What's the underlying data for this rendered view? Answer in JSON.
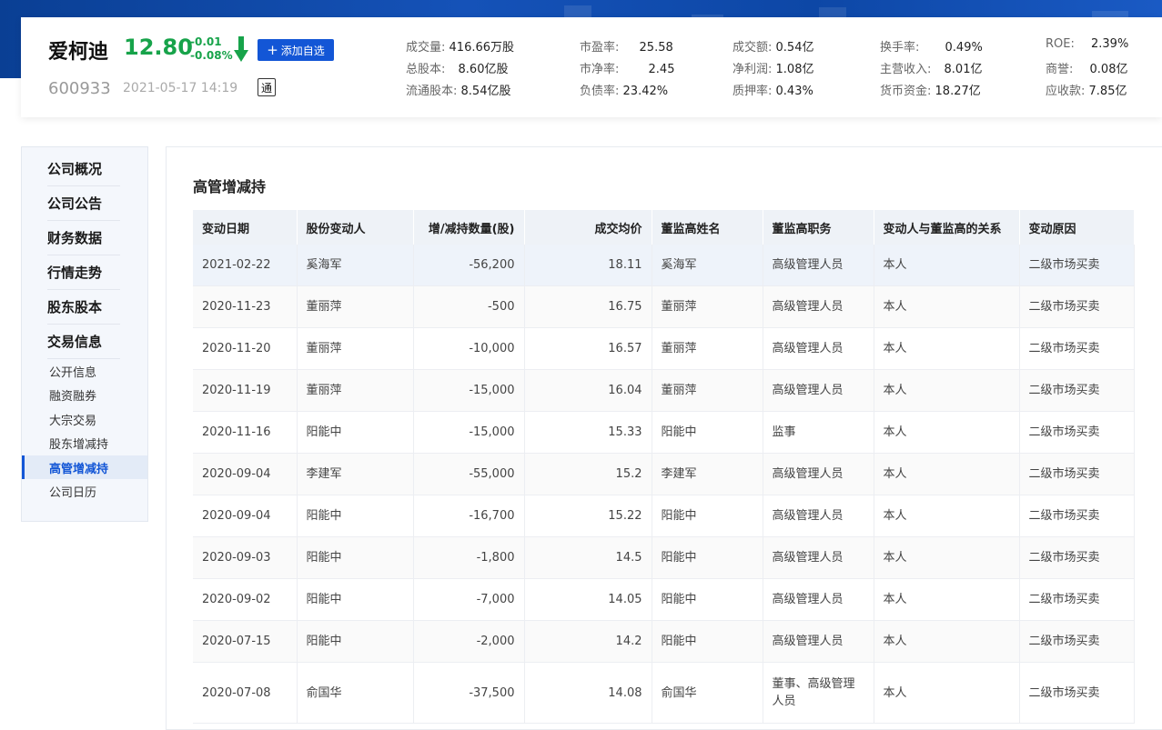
{
  "stock": {
    "name": "爱柯迪",
    "price": "12.80",
    "change": "-0.01",
    "change_pct": "-0.08%",
    "add_label": "添加自选",
    "code": "600933",
    "datetime": "2021-05-17 14:19",
    "badge": "通",
    "price_color": "#17a34a"
  },
  "metrics": [
    {
      "label": "成交量:",
      "value": "416.66万股"
    },
    {
      "label": "总股本:",
      "value": "8.60亿股"
    },
    {
      "label": "流通股本:",
      "value": "8.54亿股"
    },
    {
      "label": "市盈率:",
      "value": "25.58"
    },
    {
      "label": "市净率:",
      "value": "2.45"
    },
    {
      "label": "负债率:",
      "value": "23.42%"
    },
    {
      "label": "成交额:",
      "value": "0.54亿"
    },
    {
      "label": "净利润:",
      "value": "1.08亿"
    },
    {
      "label": "质押率:",
      "value": "0.43%"
    },
    {
      "label": "换手率:",
      "value": "0.49%"
    },
    {
      "label": "主营收入:",
      "value": "8.01亿"
    },
    {
      "label": "货币资金:",
      "value": "18.27亿"
    },
    {
      "label": "ROE:",
      "value": "2.39%"
    },
    {
      "label": "商誉:",
      "value": "0.08亿"
    },
    {
      "label": "应收款:",
      "value": "7.85亿"
    }
  ],
  "sidebar": {
    "sections": [
      "公司概况",
      "公司公告",
      "财务数据",
      "行情走势",
      "股东股本",
      "交易信息"
    ],
    "subitems": [
      "公开信息",
      "融资融券",
      "大宗交易",
      "股东增减持",
      "高管增减持",
      "公司日历"
    ],
    "active": "高管增减持"
  },
  "main": {
    "title": "高管增减持",
    "columns": [
      "变动日期",
      "股份变动人",
      "增/减持数量(股)",
      "成交均价",
      "董监高姓名",
      "董监高职务",
      "变动人与董监高的关系",
      "变动原因"
    ],
    "rows": [
      [
        "2021-02-22",
        "奚海军",
        "-56,200",
        "18.11",
        "奚海军",
        "高级管理人员",
        "本人",
        "二级市场买卖"
      ],
      [
        "2020-11-23",
        "董丽萍",
        "-500",
        "16.75",
        "董丽萍",
        "高级管理人员",
        "本人",
        "二级市场买卖"
      ],
      [
        "2020-11-20",
        "董丽萍",
        "-10,000",
        "16.57",
        "董丽萍",
        "高级管理人员",
        "本人",
        "二级市场买卖"
      ],
      [
        "2020-11-19",
        "董丽萍",
        "-15,000",
        "16.04",
        "董丽萍",
        "高级管理人员",
        "本人",
        "二级市场买卖"
      ],
      [
        "2020-11-16",
        "阳能中",
        "-15,000",
        "15.33",
        "阳能中",
        "监事",
        "本人",
        "二级市场买卖"
      ],
      [
        "2020-09-04",
        "李建军",
        "-55,000",
        "15.2",
        "李建军",
        "高级管理人员",
        "本人",
        "二级市场买卖"
      ],
      [
        "2020-09-04",
        "阳能中",
        "-16,700",
        "15.22",
        "阳能中",
        "高级管理人员",
        "本人",
        "二级市场买卖"
      ],
      [
        "2020-09-03",
        "阳能中",
        "-1,800",
        "14.5",
        "阳能中",
        "高级管理人员",
        "本人",
        "二级市场买卖"
      ],
      [
        "2020-09-02",
        "阳能中",
        "-7,000",
        "14.05",
        "阳能中",
        "高级管理人员",
        "本人",
        "二级市场买卖"
      ],
      [
        "2020-07-15",
        "阳能中",
        "-2,000",
        "14.2",
        "阳能中",
        "高级管理人员",
        "本人",
        "二级市场买卖"
      ],
      [
        "2020-07-08",
        "俞国华",
        "-37,500",
        "14.08",
        "俞国华",
        "董事、高级管理人员",
        "本人",
        "二级市场买卖"
      ]
    ]
  }
}
